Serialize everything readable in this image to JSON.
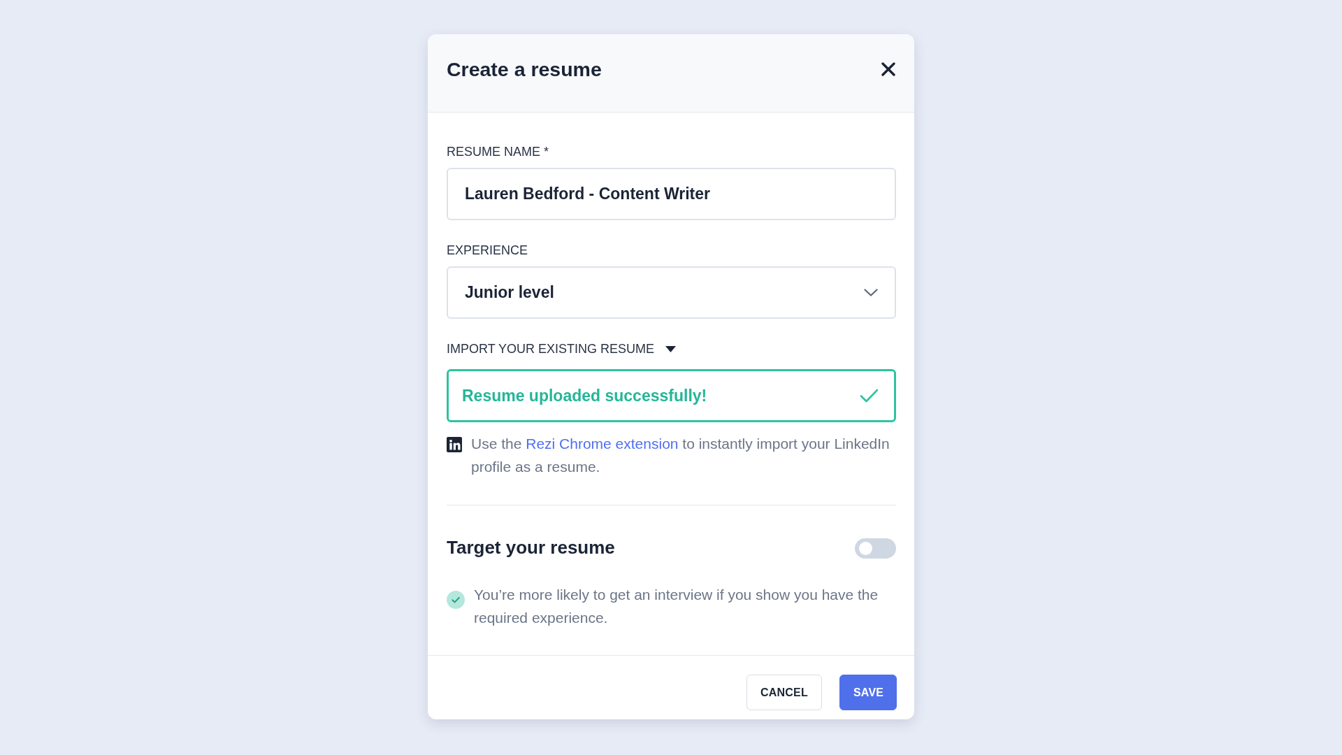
{
  "dialog": {
    "title": "Create a resume"
  },
  "fields": [
    {
      "kind": "input",
      "label": "RESUME NAME",
      "required_mark": "*",
      "value": "Lauren Bedford - Content Writer"
    },
    {
      "kind": "select",
      "label": "EXPERIENCE",
      "value": "Junior level"
    }
  ],
  "import": {
    "label": "IMPORT YOUR EXISTING RESUME",
    "expanded": true,
    "uploaded": true,
    "message": "Resume uploaded successfully!",
    "hint": {
      "before": "Use the",
      "link": "Rezi Chrome extension",
      "after": "to instantly import your LinkedIn profile as a resume."
    }
  },
  "target": {
    "title": "Target your resume",
    "on": false,
    "note": "You’re more likely to get an interview if you show you have the required experience."
  },
  "buttons": [
    {
      "kind": "secondary",
      "label": "CANCEL"
    },
    {
      "kind": "primary",
      "label": "SAVE"
    }
  ]
}
